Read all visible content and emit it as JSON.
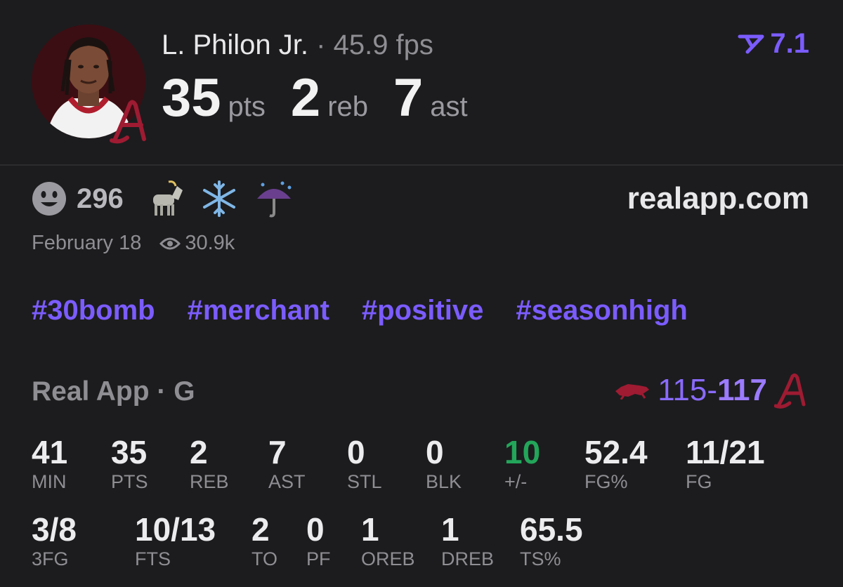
{
  "header": {
    "player_name": "L. Philon Jr.",
    "separator": "·",
    "fps": "45.9 fps",
    "rating": "7.1",
    "rating_icon": "real-logo-icon",
    "stats": [
      {
        "value": "35",
        "unit": "pts"
      },
      {
        "value": "2",
        "unit": "reb"
      },
      {
        "value": "7",
        "unit": "ast"
      }
    ]
  },
  "reactions": {
    "count": "296",
    "icons": [
      "smiley-icon",
      "goat-icon",
      "snowflake-icon",
      "umbrella-rain-icon"
    ],
    "site": "realapp.com",
    "date": "February 18",
    "views": "30.9k"
  },
  "hashtags": [
    "#30bomb",
    "#merchant",
    "#positive",
    "#seasonhigh"
  ],
  "game": {
    "source": "Real App · G",
    "away_score": "115",
    "dash": "-",
    "home_score": "117",
    "away_team_icon": "razorback-icon",
    "home_team_icon": "script-a-icon"
  },
  "box_score": {
    "row1": [
      {
        "value": "41",
        "label": "MIN"
      },
      {
        "value": "35",
        "label": "PTS"
      },
      {
        "value": "2",
        "label": "REB"
      },
      {
        "value": "7",
        "label": "AST"
      },
      {
        "value": "0",
        "label": "STL"
      },
      {
        "value": "0",
        "label": "BLK"
      },
      {
        "value": "10",
        "label": "+/-"
      },
      {
        "value": "52.4",
        "label": "FG%"
      },
      {
        "value": "11/21",
        "label": "FG"
      }
    ],
    "row2": [
      {
        "value": "3/8",
        "label": "3FG"
      },
      {
        "value": "10/13",
        "label": "FTS"
      },
      {
        "value": "2",
        "label": "TO"
      },
      {
        "value": "0",
        "label": "PF"
      },
      {
        "value": "1",
        "label": "OREB"
      },
      {
        "value": "1",
        "label": "DREB"
      },
      {
        "value": "65.5",
        "label": "TS%"
      }
    ]
  },
  "colors": {
    "accent": "#7b5cff",
    "positive": "#23a55a",
    "background": "#1c1c1e",
    "team_red": "#9e1b32"
  }
}
